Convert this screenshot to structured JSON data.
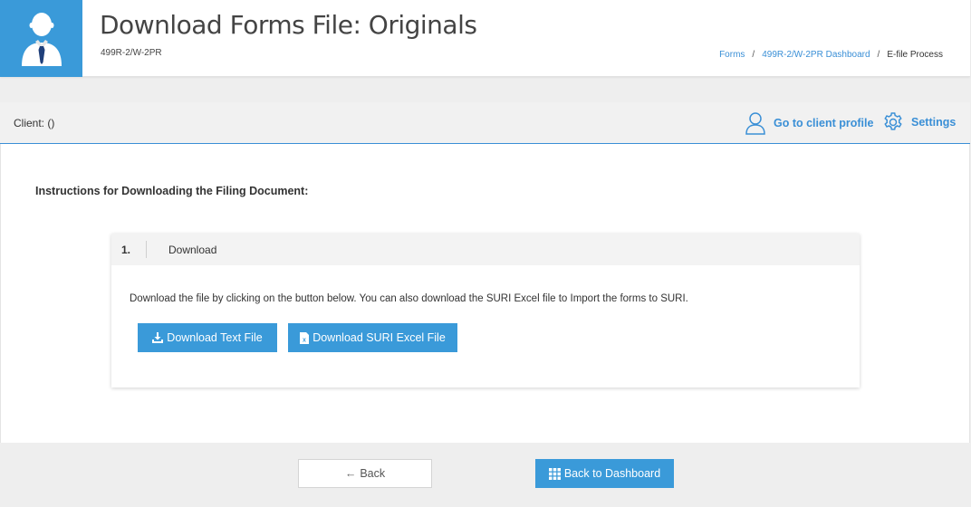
{
  "header": {
    "title": "Download Forms File: Originals",
    "subtitle": "499R-2/W-2PR",
    "avatar_icon": "user-tie-icon",
    "breadcrumb": [
      {
        "label": "Forms"
      },
      {
        "label": "499R-2/W-2PR Dashboard"
      },
      {
        "label": "E-file Process"
      }
    ],
    "breadcrumb_sep": "/"
  },
  "client_bar": {
    "client_label": "Client: ()",
    "profile_link": "Go to client profile",
    "settings_link": "Settings"
  },
  "main": {
    "instructions_title": "Instructions for Downloading the Filing Document:",
    "step": {
      "number": "1.",
      "title": "Download",
      "text": "Download the file by clicking on the button below. You can also download the SURI Excel file to Import the forms to SURI.",
      "download_text_btn": "Download Text File",
      "download_excel_btn": "Download SURI Excel File"
    }
  },
  "footer": {
    "back_btn": "Back",
    "dashboard_btn": "Back to Dashboard"
  },
  "colors": {
    "accent": "#3a9ad9",
    "link": "#3a8fd6"
  }
}
